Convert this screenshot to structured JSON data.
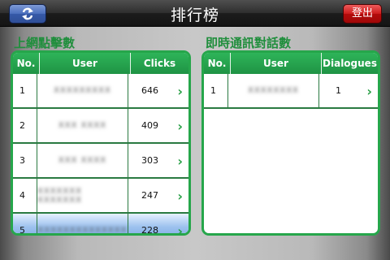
{
  "header": {
    "title": "排行榜",
    "logout_label": "登出",
    "refresh_icon": "refresh-icon"
  },
  "left_panel": {
    "title": "上網點擊數",
    "columns": [
      "No.",
      "User",
      "Clicks"
    ],
    "rows": [
      {
        "no": "1",
        "user": "XXXXXXXXX",
        "value": "646"
      },
      {
        "no": "2",
        "user": "XXX XXXX",
        "value": "409"
      },
      {
        "no": "3",
        "user": "XXX XXXX",
        "value": "303"
      },
      {
        "no": "4",
        "user": "XXXXXXX XXXXXXX",
        "value": "247"
      },
      {
        "no": "5",
        "user": "XXXXXXXXXXXXXX",
        "value": "228"
      }
    ]
  },
  "right_panel": {
    "title": "即時通訊對話數",
    "columns": [
      "No.",
      "User",
      "Dialogues"
    ],
    "rows": [
      {
        "no": "1",
        "user": "XXXXXXXX",
        "value": "1"
      }
    ]
  },
  "colors": {
    "accent_green": "#26a64b",
    "logout_red": "#cc1c1c",
    "refresh_blue": "#4b6fbd"
  }
}
